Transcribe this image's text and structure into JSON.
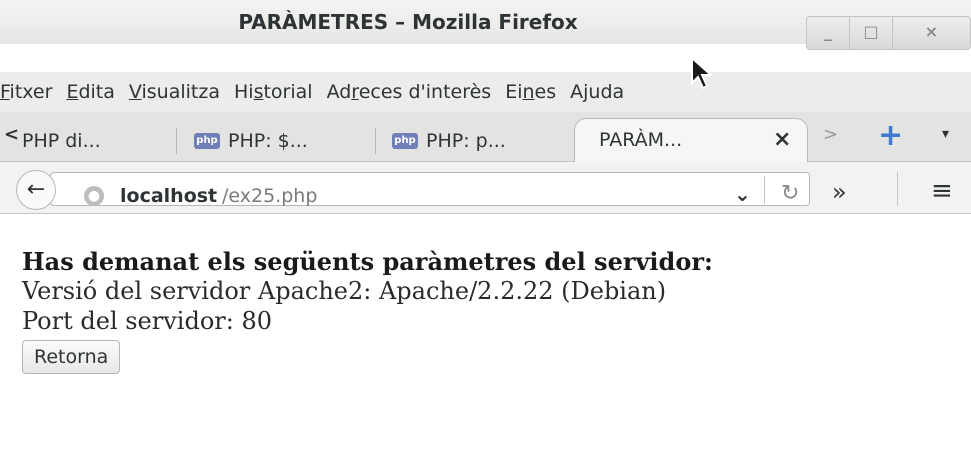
{
  "window": {
    "title": "PARÀMETRES – Mozilla Firefox",
    "minimize_glyph": "_",
    "maximize_glyph": "□",
    "close_glyph": "×"
  },
  "menubar": {
    "items": [
      {
        "pre": "",
        "u": "F",
        "post": "itxer"
      },
      {
        "pre": "",
        "u": "E",
        "post": "dita"
      },
      {
        "pre": "",
        "u": "V",
        "post": "isualitza"
      },
      {
        "pre": "Hi",
        "u": "s",
        "post": "torial"
      },
      {
        "pre": "Ad",
        "u": "r",
        "post": "eces d'interès"
      },
      {
        "pre": "Ei",
        "u": "n",
        "post": "es"
      },
      {
        "pre": "A",
        "u": "j",
        "post": "uda"
      }
    ]
  },
  "tabs": {
    "scroll_left": "<",
    "items": [
      {
        "label": "PHP di...",
        "icon": "php-icon"
      },
      {
        "label": "PHP: $...",
        "icon": "php-icon"
      },
      {
        "label": "PHP: p...",
        "icon": "php-icon"
      }
    ],
    "active_label": "PARÀM...",
    "close_glyph": "×",
    "scroll_right": ">",
    "new_tab": "+",
    "list_glyph": "▾",
    "php_icon_text": "php"
  },
  "navbar": {
    "back_glyph": "←",
    "url_host": "localhost",
    "url_path": "/ex25.php",
    "dropdown_glyph": "⌄",
    "reload_glyph": "↻",
    "overflow_glyph": "»",
    "menu_glyph": "≡"
  },
  "page": {
    "heading": "Has demanat els següents paràmetres del servidor:",
    "server_version": "Versió del servidor Apache2: Apache/2.2.22 (Debian)",
    "server_port": "Port del servidor: 80",
    "return_button": "Retorna"
  },
  "colors": {
    "accent_new_tab": "#3e7bd0",
    "php_icon": "#6f7fb7"
  }
}
